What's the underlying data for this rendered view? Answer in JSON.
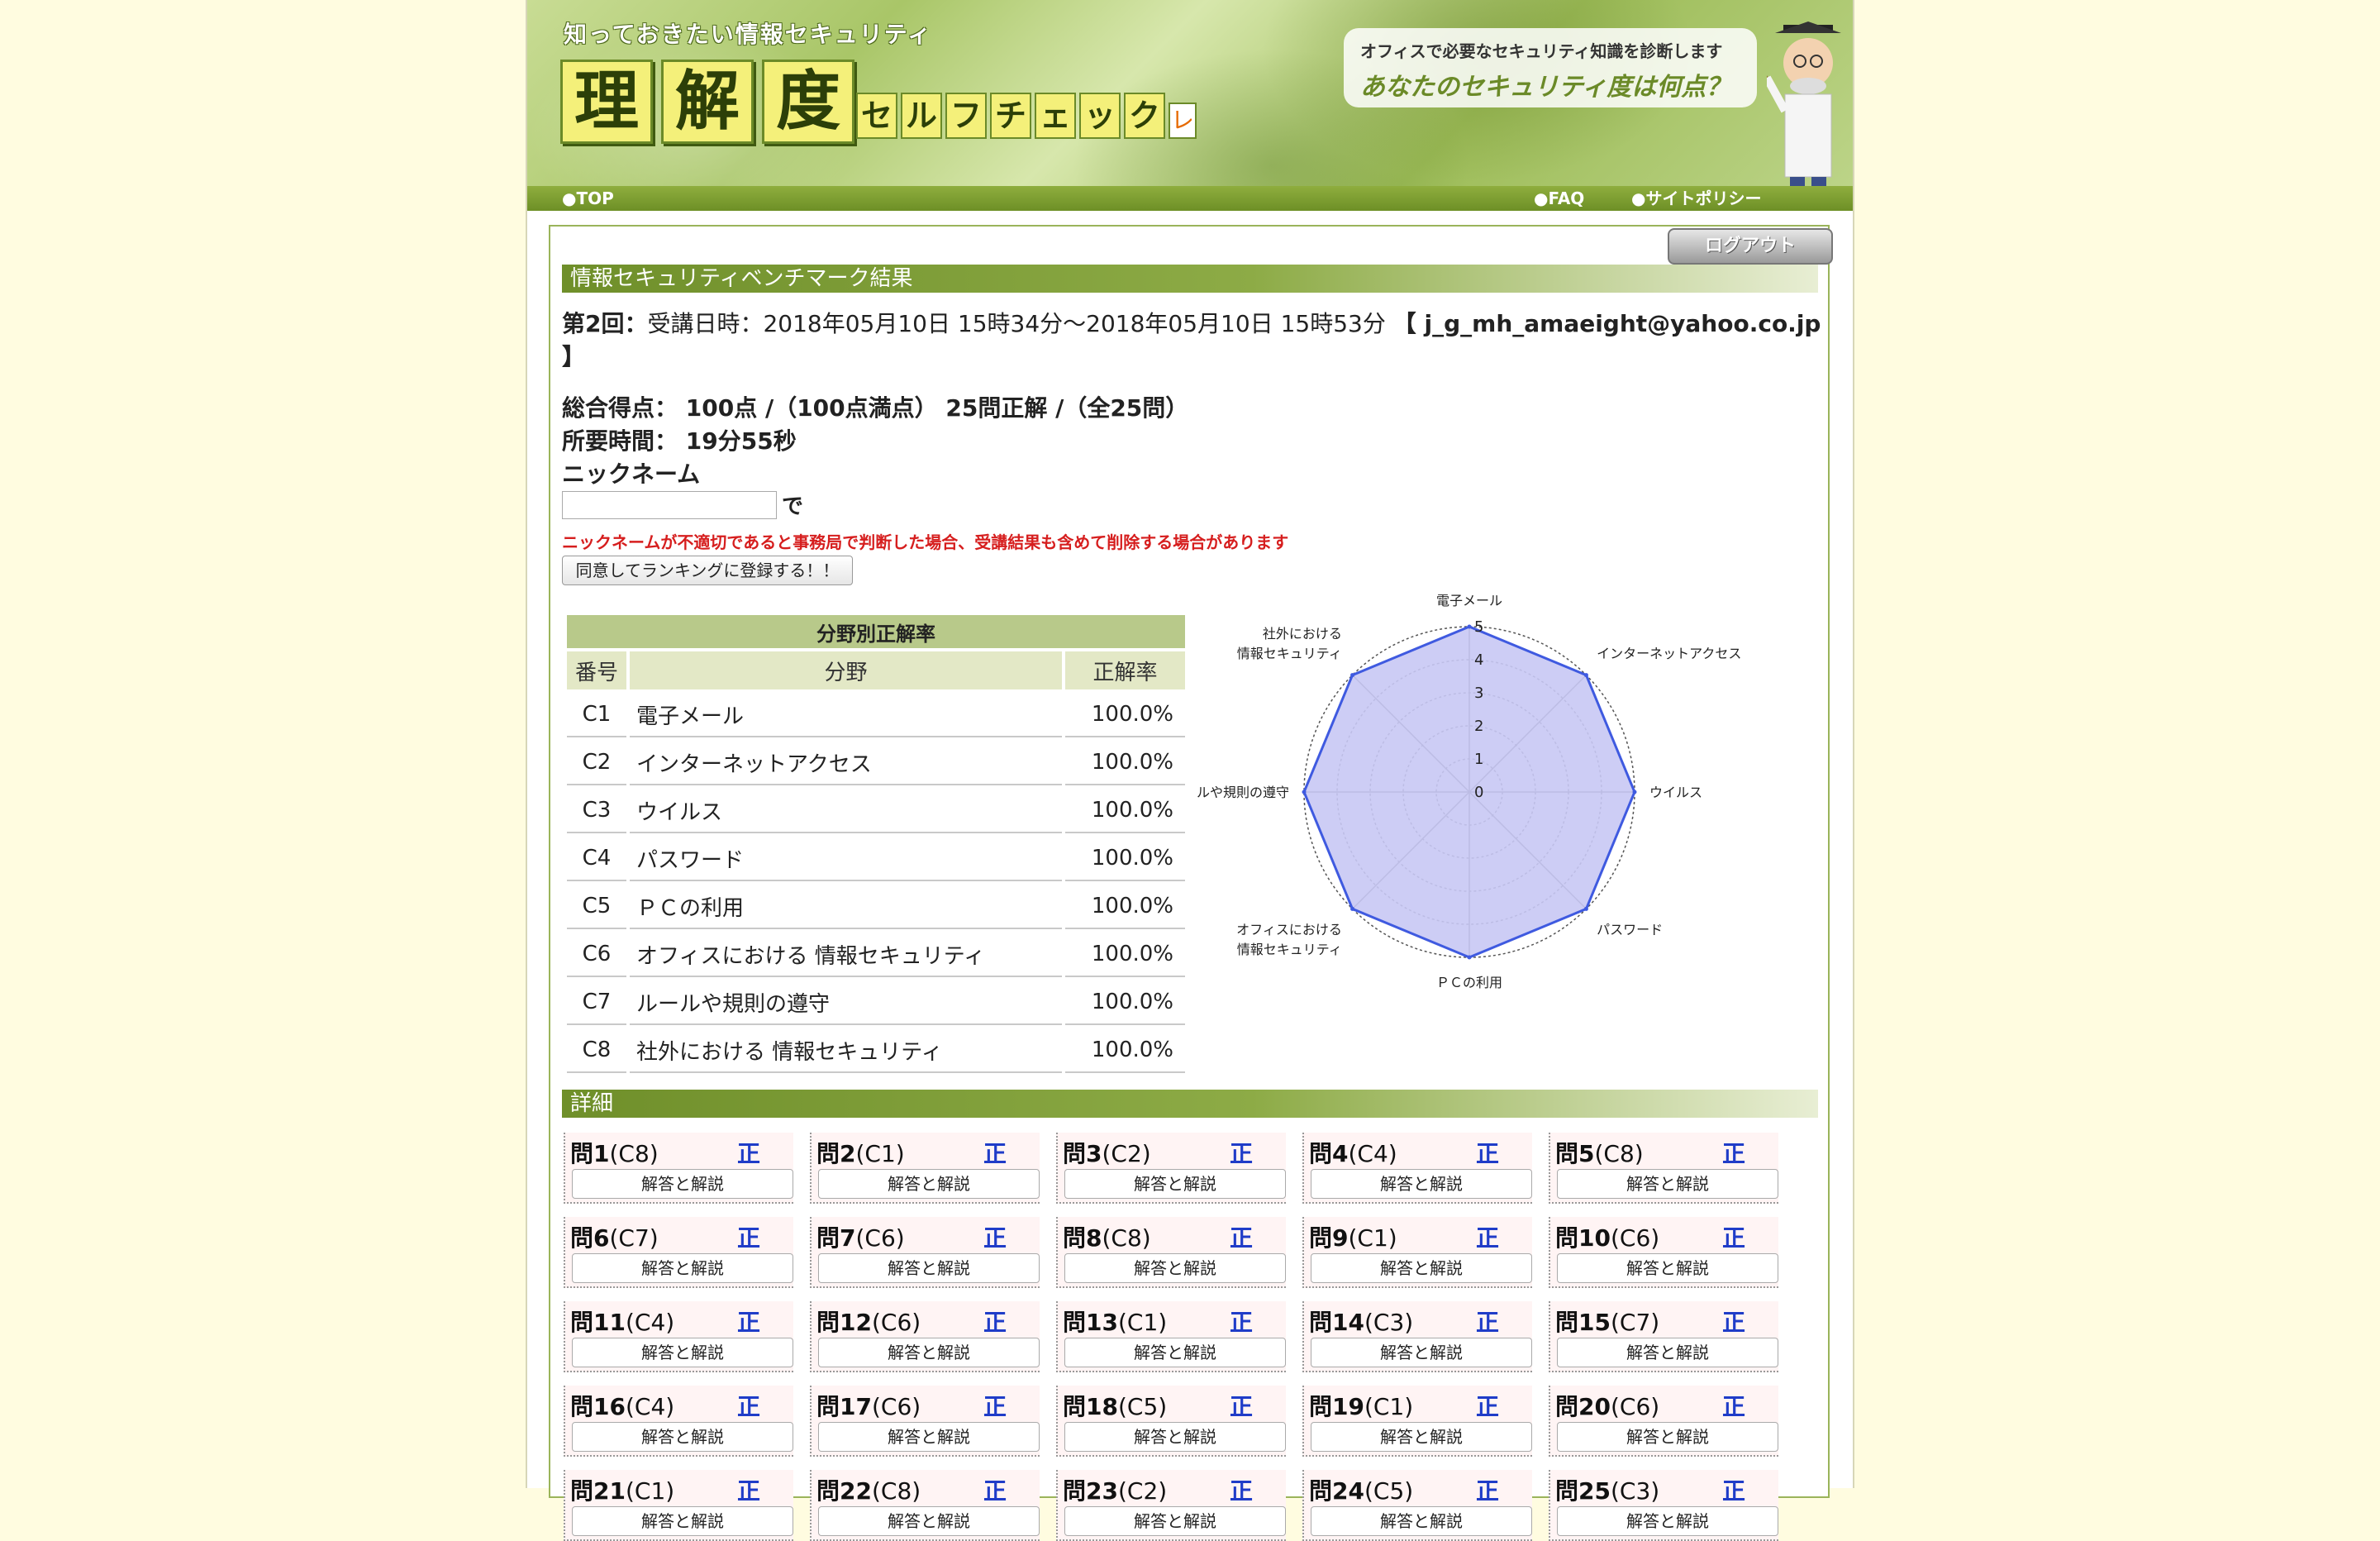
{
  "header": {
    "tagline": "知っておきたい情報セキュリティ",
    "logo_main": [
      "理",
      "解",
      "度"
    ],
    "logo_sub": [
      "セ",
      "ル",
      "フ",
      "チ",
      "ェ",
      "ッ",
      "ク"
    ],
    "logo_check": "レ",
    "bubble_line1": "オフィスで必要なセキュリティ知識を診断します",
    "bubble_line2": "あなたのセキュリティ度は何点？"
  },
  "nav": {
    "top": "●TOP",
    "faq": "●FAQ",
    "policy": "●サイトポリシー"
  },
  "logout_label": "ログアウト",
  "result": {
    "section_title": "情報セキュリティベンチマーク結果",
    "round": "第2回：",
    "line1": "受講日時：2018年05月10日 15時34分〜2018年05月10日 15時53分",
    "email_bracket": "【 j_g_mh_amaeight@yahoo.co.jp",
    "email_close": "】",
    "score_label": "総合得点：",
    "score_value": "100点 /（100点満点） 25問正解 /（全25問）",
    "time_label": "所要時間：",
    "time_value": "19分55秒",
    "nickname_label": "ニックネーム",
    "nickname_value": "",
    "de": "で",
    "warning": "ニックネームが不適切であると事務局で判断した場合、受講結果も含めて削除する場合があります",
    "register_button": "同意してランキングに登録する！！"
  },
  "table": {
    "caption": "分野別正解率",
    "headers": [
      "番号",
      "分野",
      "正解率"
    ],
    "rows": [
      [
        "C1",
        "電子メール",
        "100.0%"
      ],
      [
        "C2",
        "インターネットアクセス",
        "100.0%"
      ],
      [
        "C3",
        "ウイルス",
        "100.0%"
      ],
      [
        "C4",
        "パスワード",
        "100.0%"
      ],
      [
        "C5",
        "ＰＣの利用",
        "100.0%"
      ],
      [
        "C6",
        "オフィスにおける 情報セキュリティ",
        "100.0%"
      ],
      [
        "C7",
        "ルールや規則の遵守",
        "100.0%"
      ],
      [
        "C8",
        "社外における 情報セキュリティ",
        "100.0%"
      ]
    ]
  },
  "chart_data": {
    "type": "radar",
    "categories": [
      "電子メール",
      "インターネットアクセス",
      "ウイルス",
      "パスワード",
      "ＰＣの利用",
      "オフィスにおける 情報セキュリティ",
      "ルールや規則の遵守",
      "社外における 情報セキュリティ"
    ],
    "label_lines": [
      [
        "電子メール"
      ],
      [
        "インターネットアクセス"
      ],
      [
        "ウイルス"
      ],
      [
        "パスワード"
      ],
      [
        "ＰＣの利用"
      ],
      [
        "オフィスにおける",
        "情報セキュリティ"
      ],
      [
        "ルールや規則の遵守"
      ],
      [
        "社外における",
        "情報セキュリティ"
      ]
    ],
    "series": [
      {
        "values": [
          5,
          5,
          5,
          5,
          5,
          5,
          5,
          5
        ]
      }
    ],
    "rlim": [
      0,
      5
    ],
    "ticks": [
      "0",
      "1",
      "2",
      "3",
      "4",
      "5"
    ],
    "fill_color": "#c8c8f4",
    "line_color": "#3f5ae0"
  },
  "details": {
    "section_title": "詳細",
    "prefix": "問",
    "correct_mark": "正",
    "explain_label": "解答と解説",
    "questions": [
      [
        "1",
        "(C8)"
      ],
      [
        "2",
        "(C1)"
      ],
      [
        "3",
        "(C2)"
      ],
      [
        "4",
        "(C4)"
      ],
      [
        "5",
        "(C8)"
      ],
      [
        "6",
        "(C7)"
      ],
      [
        "7",
        "(C6)"
      ],
      [
        "8",
        "(C8)"
      ],
      [
        "9",
        "(C1)"
      ],
      [
        "10",
        "(C6)"
      ],
      [
        "11",
        "(C4)"
      ],
      [
        "12",
        "(C6)"
      ],
      [
        "13",
        "(C1)"
      ],
      [
        "14",
        "(C3)"
      ],
      [
        "15",
        "(C7)"
      ],
      [
        "16",
        "(C4)"
      ],
      [
        "17",
        "(C6)"
      ],
      [
        "18",
        "(C5)"
      ],
      [
        "19",
        "(C1)"
      ],
      [
        "20",
        "(C6)"
      ],
      [
        "21",
        "(C1)"
      ],
      [
        "22",
        "(C8)"
      ],
      [
        "23",
        "(C2)"
      ],
      [
        "24",
        "(C5)"
      ],
      [
        "25",
        "(C3)"
      ]
    ]
  }
}
